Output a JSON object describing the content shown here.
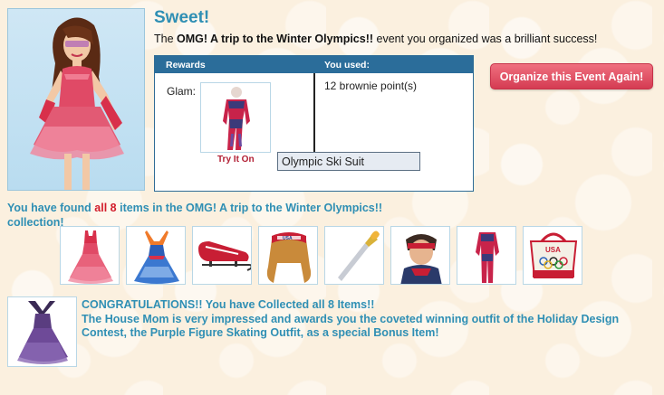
{
  "header": {
    "title": "Sweet!",
    "event_prefix": "The ",
    "event_name": "OMG! A trip to the Winter Olympics!!",
    "event_suffix": " event you organized was a brilliant success!"
  },
  "rewards": {
    "col_rewards": "Rewards",
    "col_used": "You used:",
    "category_label": "Glam:",
    "try_it_on": "Try It On",
    "used_value": "12 brownie point(s)",
    "tooltip": "Olympic Ski Suit"
  },
  "actions": {
    "organize_again": "Organize this Event Again!"
  },
  "collection": {
    "found_prefix": "You have found ",
    "found_all": "all 8",
    "found_suffix": " items in the OMG! A trip to the Winter Olympics!! collection!",
    "items": [
      {
        "icon": "pink-skating-dress-icon"
      },
      {
        "icon": "blue-skating-dress-icon"
      },
      {
        "icon": "bobsled-icon"
      },
      {
        "icon": "usa-headband-hair-icon"
      },
      {
        "icon": "olympic-torch-icon"
      },
      {
        "icon": "male-skier-icon"
      },
      {
        "icon": "ski-suit-icon"
      },
      {
        "icon": "usa-olympic-tote-icon"
      }
    ]
  },
  "bonus": {
    "line1": "CONGRATULATIONS!! You have Collected all 8 Items!!",
    "line2": "The House Mom is very impressed and awards you the coveted winning outfit of the Holiday Design Contest, the Purple Figure Skating Outfit, as a special Bonus Item!",
    "icon": "purple-skating-outfit-icon"
  }
}
